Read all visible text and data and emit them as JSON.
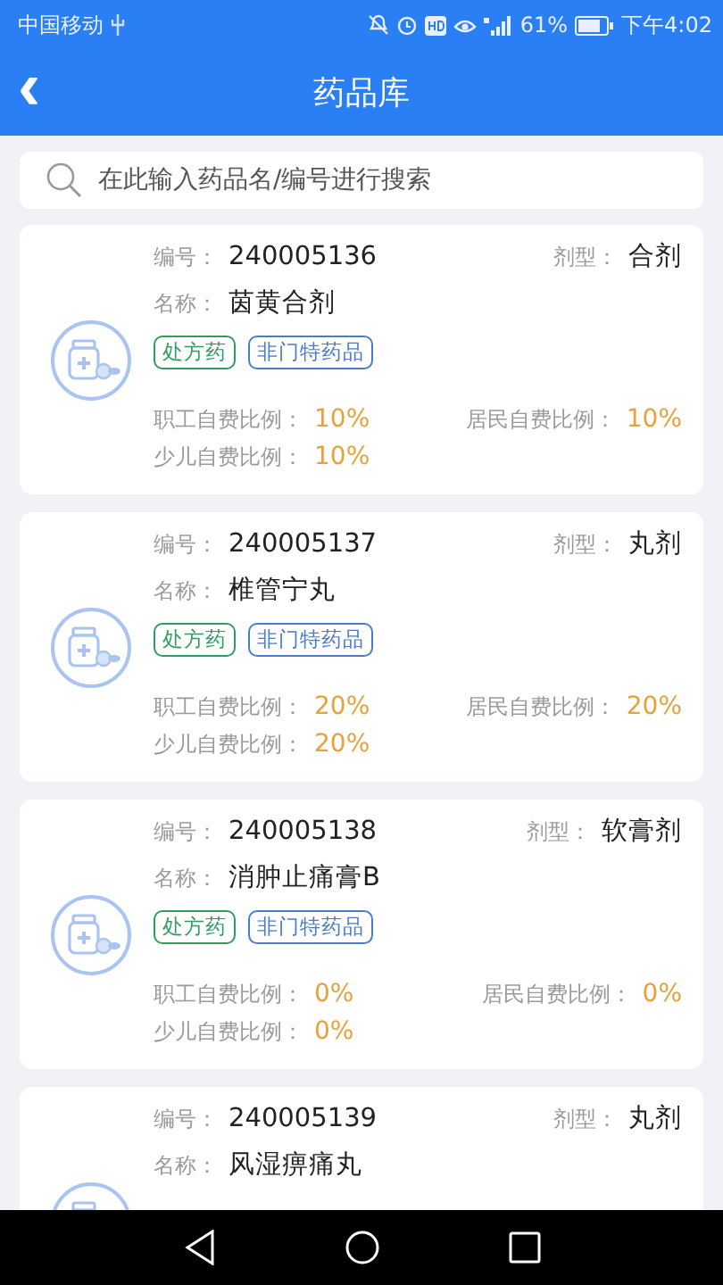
{
  "status_bar": {
    "carrier": "中国移动",
    "battery": "61%",
    "time": "下午4:02"
  },
  "header": {
    "back": "‹",
    "title": "药品库"
  },
  "search": {
    "placeholder": "在此输入药品名/编号进行搜索"
  },
  "drugs": [
    {
      "code_label": "编号：",
      "code": "240005136",
      "form_label": "剂型：",
      "form": "合剂",
      "name_label": "名称：",
      "name": "茵黄合剂",
      "tags": [
        {
          "text": "处方药",
          "kind": "rx"
        },
        {
          "text": "非门特药品",
          "kind": "category"
        }
      ],
      "ratios": [
        {
          "label": "职工自费比例：",
          "value": "10%"
        },
        {
          "label": "居民自费比例：",
          "value": "10%"
        },
        {
          "label": "少儿自费比例：",
          "value": "10%"
        }
      ]
    },
    {
      "code_label": "编号：",
      "code": "240005137",
      "form_label": "剂型：",
      "form": "丸剂",
      "name_label": "名称：",
      "name": "椎管宁丸",
      "tags": [
        {
          "text": "处方药",
          "kind": "rx"
        },
        {
          "text": "非门特药品",
          "kind": "category"
        }
      ],
      "ratios": [
        {
          "label": "职工自费比例：",
          "value": "20%"
        },
        {
          "label": "居民自费比例：",
          "value": "20%"
        },
        {
          "label": "少儿自费比例：",
          "value": "20%"
        }
      ]
    },
    {
      "code_label": "编号：",
      "code": "240005138",
      "form_label": "剂型：",
      "form": "软膏剂",
      "name_label": "名称：",
      "name": "消肿止痛膏B",
      "tags": [
        {
          "text": "处方药",
          "kind": "rx"
        },
        {
          "text": "非门特药品",
          "kind": "category"
        }
      ],
      "ratios": [
        {
          "label": "职工自费比例：",
          "value": "0%"
        },
        {
          "label": "居民自费比例：",
          "value": "0%"
        },
        {
          "label": "少儿自费比例：",
          "value": "0%"
        }
      ]
    },
    {
      "code_label": "编号：",
      "code": "240005139",
      "form_label": "剂型：",
      "form": "丸剂",
      "name_label": "名称：",
      "name": "风湿痹痛丸"
    }
  ]
}
